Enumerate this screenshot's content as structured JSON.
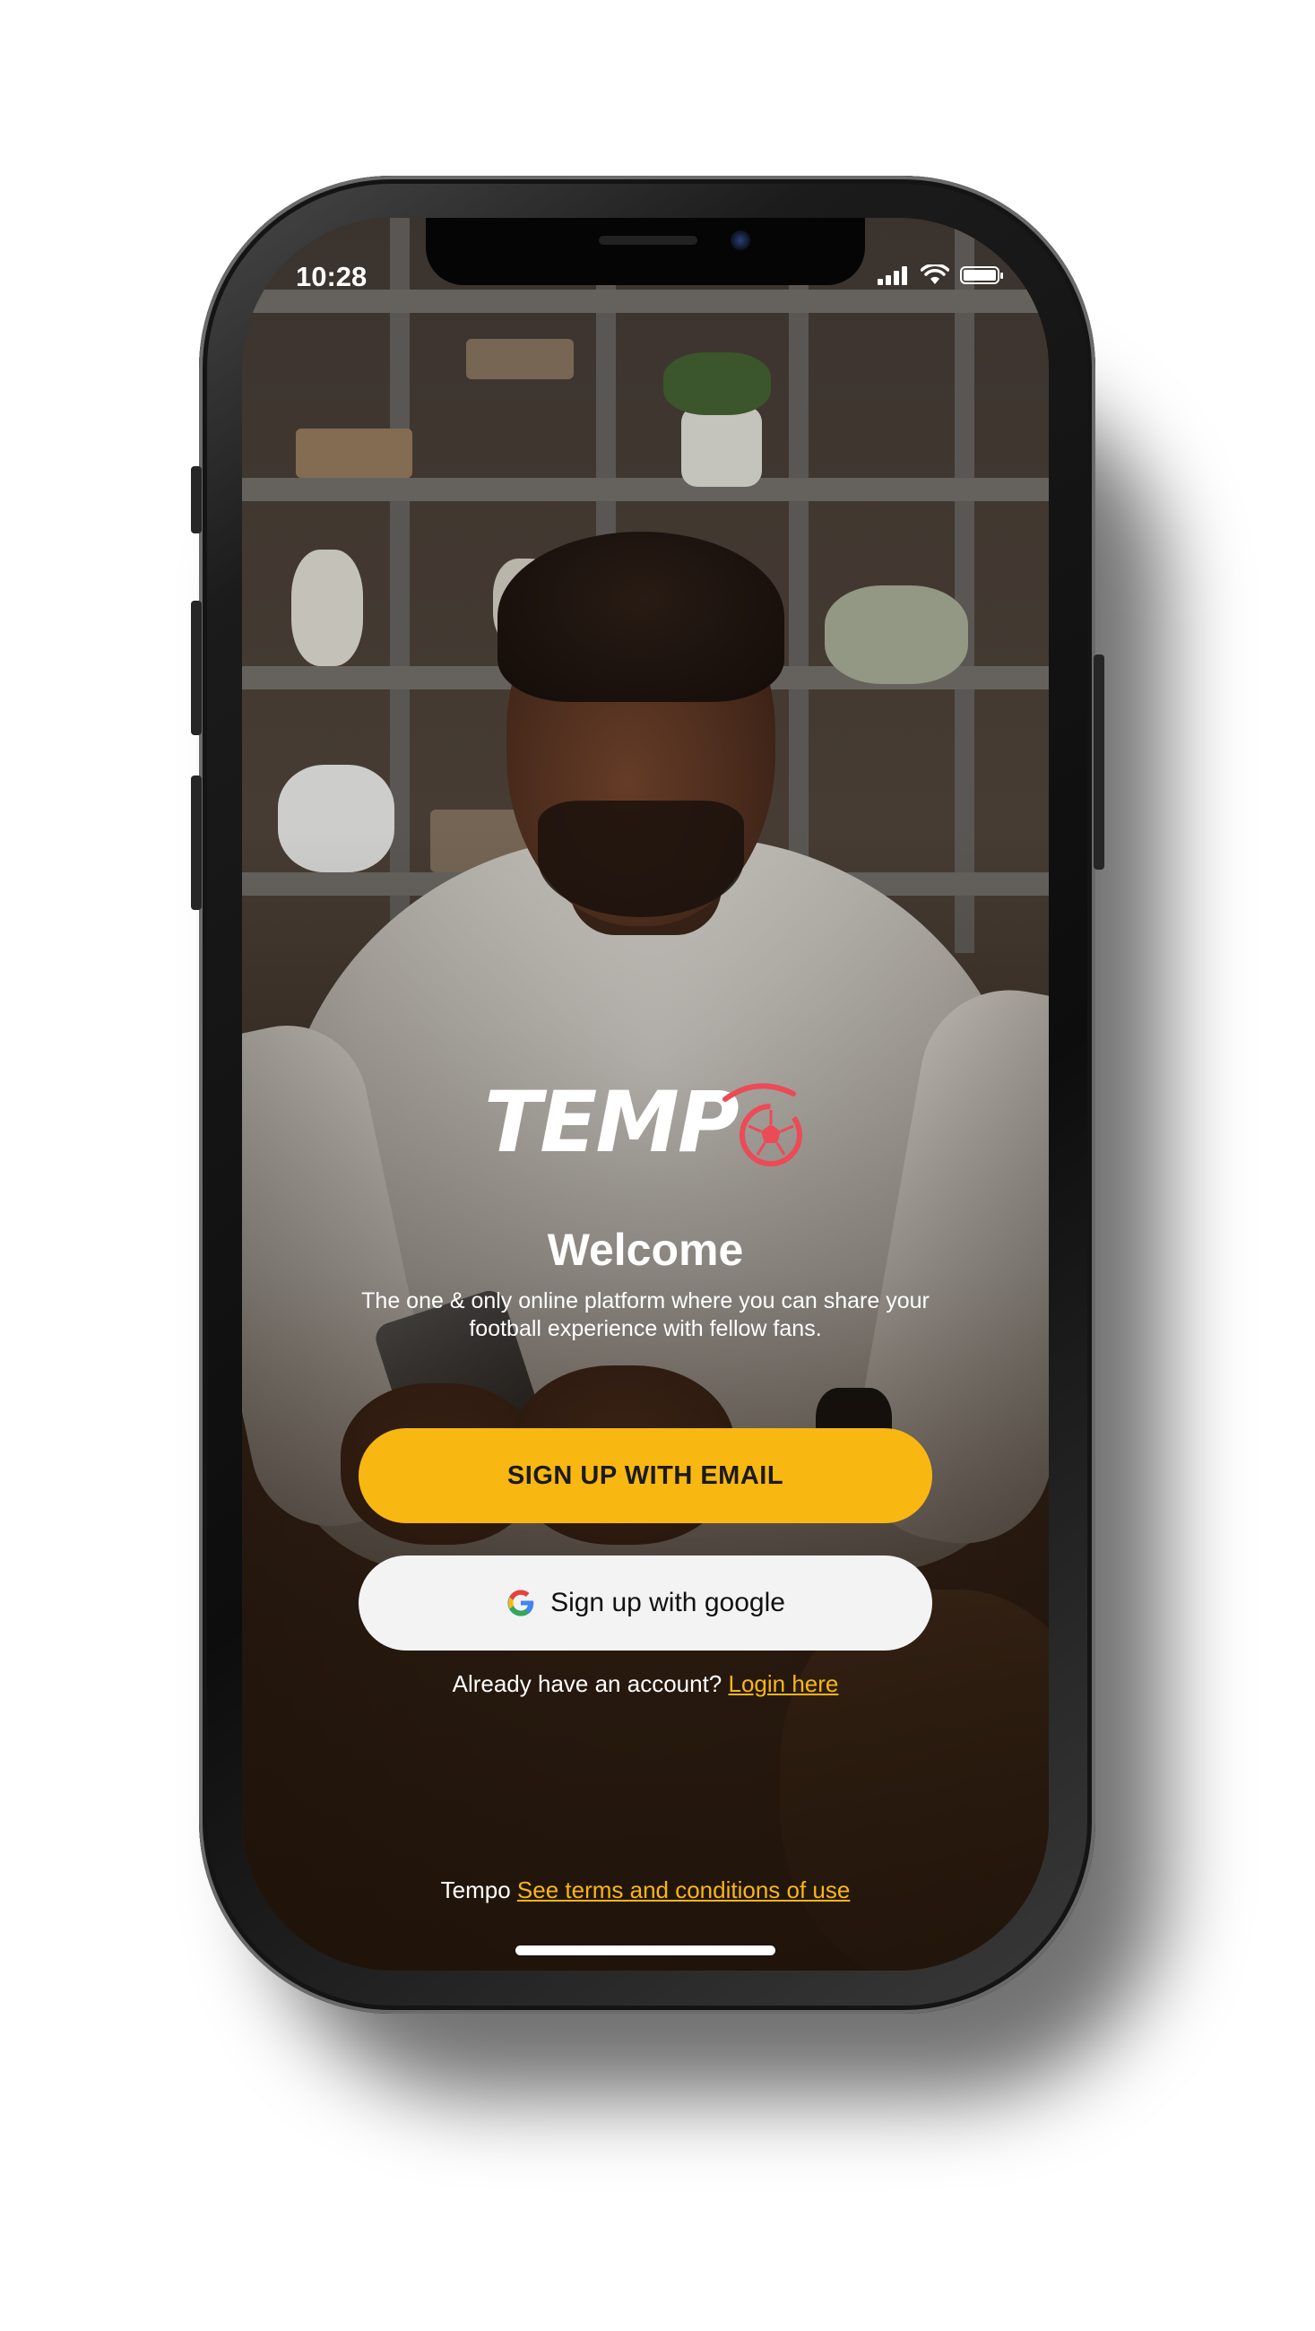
{
  "status_bar": {
    "time": "10:28",
    "icons": [
      "signal-icon",
      "wifi-icon",
      "battery-icon"
    ],
    "battery_level": 1.0
  },
  "brand": {
    "logo_text": "TEMP",
    "logo_icon": "soccer-ball-icon",
    "accent_color": "#f9b712",
    "logo_accent_color": "#ec4a57"
  },
  "main": {
    "title": "Welcome",
    "subtitle": "The one & only online platform where you can share your football experience with fellow fans.",
    "email_button_label": "SIGN UP WITH EMAIL",
    "google_button_label": "Sign up with google",
    "google_icon": "google-icon",
    "login_prompt": "Already have an account?",
    "login_link": "Login here"
  },
  "footer": {
    "brand_text": "Tempo",
    "terms_link": "See terms and conditions of use"
  }
}
